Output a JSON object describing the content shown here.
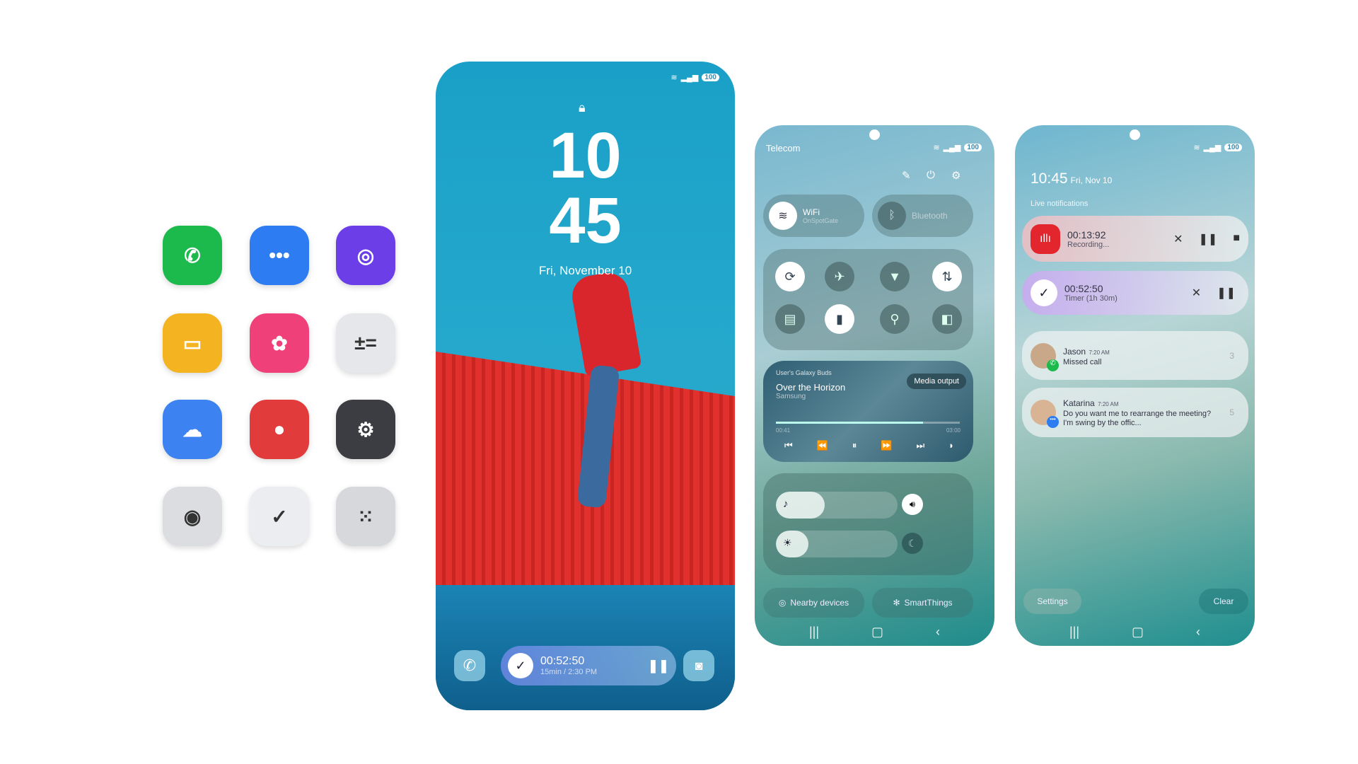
{
  "app_icons": [
    {
      "name": "phone",
      "glyph": "✆",
      "bg": "#1cb94c"
    },
    {
      "name": "messages",
      "glyph": "•••",
      "bg": "#2d7cf2"
    },
    {
      "name": "internet",
      "glyph": "◎",
      "bg": "#6b3ee8"
    },
    {
      "name": "my-files",
      "glyph": "▭",
      "bg": "#f4b321"
    },
    {
      "name": "gallery",
      "glyph": "✿",
      "bg": "#f0407a"
    },
    {
      "name": "calculator",
      "glyph": "±=",
      "bg": "#e6e7ea"
    },
    {
      "name": "cloud",
      "glyph": "☁",
      "bg": "#3c82f0"
    },
    {
      "name": "contacts",
      "glyph": "●",
      "bg": "#e23b3b"
    },
    {
      "name": "settings",
      "glyph": "⚙",
      "bg": "#3b3d42"
    },
    {
      "name": "camera",
      "glyph": "◉",
      "bg": "#dcdde0"
    },
    {
      "name": "clock",
      "glyph": "✓",
      "bg": "#ecedf0"
    },
    {
      "name": "voice-recorder",
      "glyph": "⁙",
      "bg": "#d6d8dc"
    }
  ],
  "lock": {
    "battery": "100",
    "hour": "10",
    "minute": "45",
    "date": "Fri, November 10",
    "timer": {
      "time": "00:52:50",
      "sub": "15min / 2:30 PM"
    }
  },
  "control": {
    "carrier": "Telecom",
    "battery": "100",
    "wifi_label": "WiFi",
    "wifi_network": "OnSpotGate",
    "bluetooth_label": "Bluetooth",
    "media": {
      "source": "User's Galaxy Buds",
      "title": "Over the Horizon",
      "artist": "Samsung",
      "output_label": "Media output",
      "elapsed": "00:41",
      "duration": "03:00",
      "progress": 0.8
    },
    "volume_level": 0.4,
    "brightness_level": 0.27,
    "nearby_label": "Nearby devices",
    "smartthings_label": "SmartThings"
  },
  "notifications": {
    "battery": "100",
    "time": "10:45",
    "date": "Fri, Nov 10",
    "section": "Live notifications",
    "recording": {
      "time": "00:13:92",
      "status": "Recording..."
    },
    "timer": {
      "time": "00:52:50",
      "status": "Timer (1h 30m)"
    },
    "items": [
      {
        "name": "Jason",
        "time": "7:20 AM",
        "text": "Missed call",
        "count": "3"
      },
      {
        "name": "Katarina",
        "time": "7:20 AM",
        "text": "Do you want me to rearrange the meeting? I'm swing by the offic...",
        "count": "5"
      }
    ],
    "settings_label": "Settings",
    "clear_label": "Clear"
  }
}
